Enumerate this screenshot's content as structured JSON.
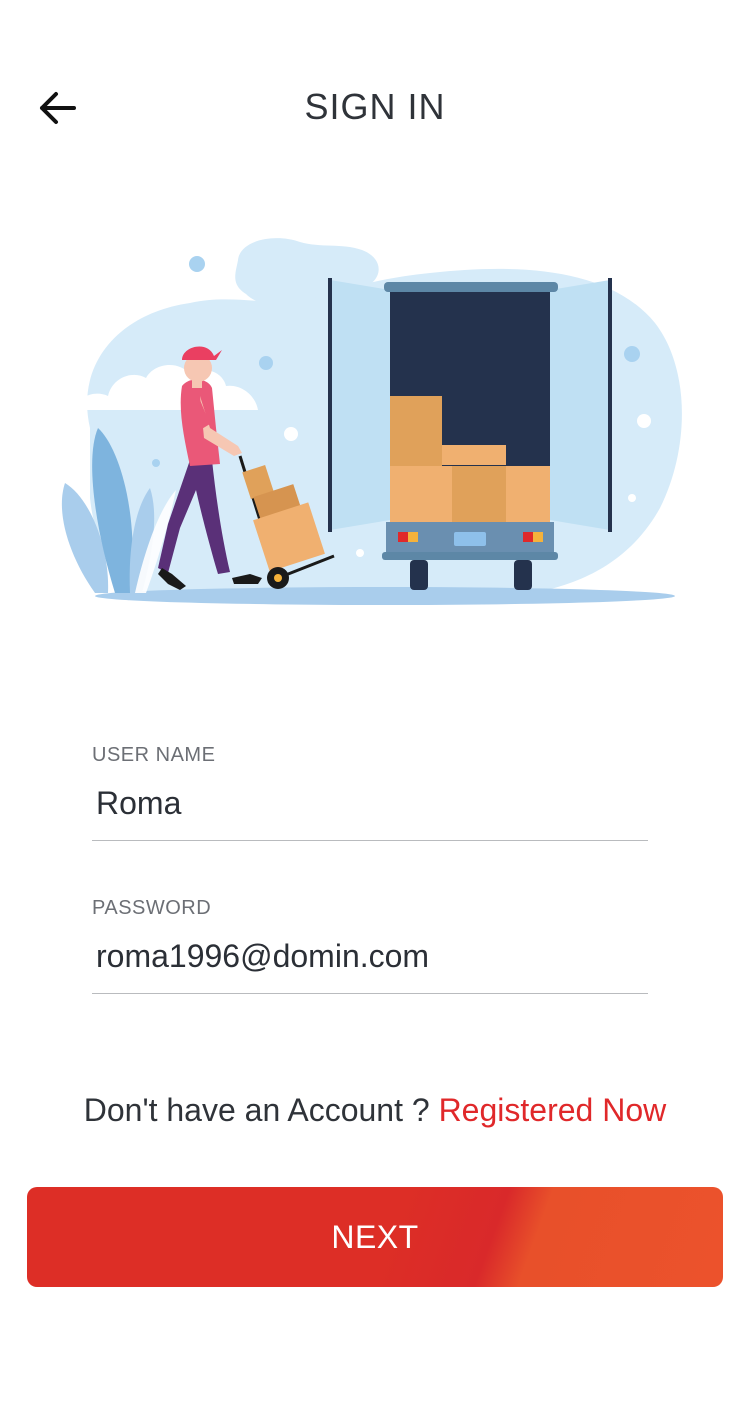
{
  "header": {
    "title": "SIGN IN",
    "back_icon": "arrow-left-icon"
  },
  "illustration": {
    "subject": "delivery-truck-illustration"
  },
  "form": {
    "username": {
      "label": "USER NAME",
      "value": "Roma"
    },
    "password": {
      "label": "PASSWORD",
      "value": "roma1996@domin.com"
    }
  },
  "signup": {
    "prompt": "Don't have an Account ? ",
    "link": "Registered Now"
  },
  "actions": {
    "next_label": "NEXT"
  },
  "colors": {
    "accent": "#e0282a",
    "button_start": "#dd2e26",
    "button_end": "#ec522c",
    "illustration_bg": "#d6ebf9",
    "truck_dark": "#24324d"
  }
}
